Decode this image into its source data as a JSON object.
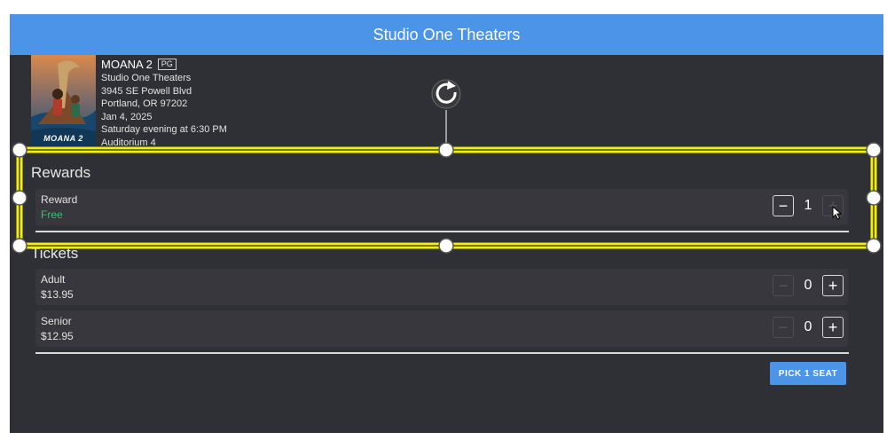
{
  "header": {
    "title": "Studio One Theaters"
  },
  "movie": {
    "poster_text": "MOANA 2",
    "title": "MOANA 2",
    "rating": "PG",
    "theater": "Studio One Theaters",
    "address_line1": "3945 SE Powell Blvd",
    "address_line2": "Portland, OR 97202",
    "date": "Jan 4, 2025",
    "showtime": "Saturday evening at 6:30 PM",
    "auditorium": "Auditorium 4"
  },
  "rewards": {
    "title": "Rewards",
    "items": [
      {
        "name": "Reward",
        "price": "Free",
        "quantity": "1"
      }
    ]
  },
  "tickets": {
    "title": "Tickets",
    "items": [
      {
        "name": "Adult",
        "price": "$13.95",
        "quantity": "0"
      },
      {
        "name": "Senior",
        "price": "$12.95",
        "quantity": "0"
      }
    ]
  },
  "buttons": {
    "minus": "−",
    "plus": "+",
    "pick_seat": "PICK 1 SEAT"
  },
  "colors": {
    "header": "#4b94e8",
    "background": "#2f3035",
    "row": "#37373d",
    "free": "#3fbf73",
    "selection_outline": "#f4f000",
    "primary_button": "#4b94e8"
  },
  "icons": {
    "rotate": "rotate-handle-icon",
    "resize": "resize-handle-icon",
    "cursor": "mouse-pointer-icon"
  }
}
